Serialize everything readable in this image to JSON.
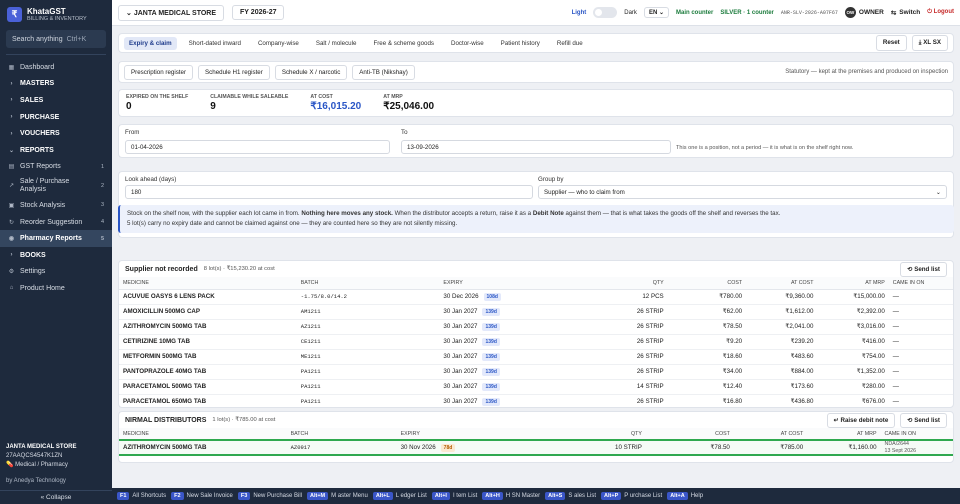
{
  "brand": {
    "name": "KhataGST",
    "sub": "BILLING & INVENTORY",
    "logo": "₹"
  },
  "sidebar": {
    "search_placeholder": "Search anything",
    "search_shortcut": "Ctrl+K",
    "items": [
      {
        "label": "Dashboard",
        "icon": "grid-icon",
        "glyph": "▦",
        "group": false
      },
      {
        "label": "MASTERS",
        "icon": "chevron-right-icon",
        "glyph": "›",
        "group": true
      },
      {
        "label": "SALES",
        "icon": "chevron-right-icon",
        "glyph": "›",
        "group": true
      },
      {
        "label": "PURCHASE",
        "icon": "chevron-right-icon",
        "glyph": "›",
        "group": true
      },
      {
        "label": "VOUCHERS",
        "icon": "chevron-right-icon",
        "glyph": "›",
        "group": true
      },
      {
        "label": "REPORTS",
        "icon": "chevron-down-icon",
        "glyph": "⌄",
        "group": true
      },
      {
        "label": "GST Reports",
        "icon": "report-icon",
        "glyph": "▤",
        "count": "1"
      },
      {
        "label": "Sale / Purchase Analysis",
        "icon": "chart-icon",
        "glyph": "↗",
        "count": "2",
        "two": true
      },
      {
        "label": "Stock Analysis",
        "icon": "box-icon",
        "glyph": "▣",
        "count": "3"
      },
      {
        "label": "Reorder Suggestion",
        "icon": "refresh-icon",
        "glyph": "↻",
        "count": "4"
      },
      {
        "label": "Pharmacy Reports",
        "icon": "pill-icon",
        "glyph": "◉",
        "count": "5",
        "active": true
      },
      {
        "label": "BOOKS",
        "icon": "chevron-right-icon",
        "glyph": "›",
        "group": true
      },
      {
        "label": "Settings",
        "icon": "gear-icon",
        "glyph": "⚙"
      },
      {
        "label": "Product Home",
        "icon": "home-icon",
        "glyph": "⌂"
      }
    ],
    "shop_name": "JANTA MEDICAL STORE",
    "shop_gstin": "27AAQCS4547K1ZN",
    "shop_type": "Medical / Pharmacy",
    "powered": "by Anedya Technology",
    "collapse": "« Collapse"
  },
  "topbar": {
    "store": "JANTA MEDICAL STORE",
    "fy": "FY 2026-27",
    "light": "Light",
    "dark": "Dark",
    "lang": "EN",
    "main_counter": "Main counter",
    "plan": "SILVER · 1 counter",
    "license": "ANR-SLV-2026-A07F67",
    "avatar": "OW",
    "owner": "OWNER",
    "switch": "Switch",
    "logout": "Logout"
  },
  "tabs": [
    {
      "label": "Expiry & claim",
      "active": true
    },
    {
      "label": "Short-dated inward"
    },
    {
      "label": "Company-wise"
    },
    {
      "label": "Salt / molecule"
    },
    {
      "label": "Free & scheme goods"
    },
    {
      "label": "Doctor-wise"
    },
    {
      "label": "Patient history"
    },
    {
      "label": "Refill due"
    }
  ],
  "tab_actions": {
    "reset": "Reset",
    "xlsx": "XL SX"
  },
  "subtabs": [
    "Prescription register",
    "Schedule H1 register",
    "Schedule X / narcotic",
    "Anti-TB (Nikshay)"
  ],
  "statutory_note": "Statutory — kept at the premises and produced on inspection",
  "stats": [
    {
      "label": "EXPIRED ON THE SHELF",
      "value": "0"
    },
    {
      "label": "CLAIMABLE WHILE SALEABLE",
      "value": "9"
    },
    {
      "label": "AT COST",
      "value": "₹16,015.20",
      "blue": true
    },
    {
      "label": "AT MRP",
      "value": "₹25,046.00"
    }
  ],
  "filters": {
    "from_label": "From",
    "from_value": "01-04-2026",
    "to_label": "To",
    "to_value": "13-09-2026",
    "position_note": "This one is a position, not a period — it is what is on the shelf right now.",
    "lookahead_label": "Look ahead (days)",
    "lookahead_value": "180",
    "groupby_label": "Group by",
    "groupby_value": "Supplier — who to claim from"
  },
  "info": {
    "p1": "Stock on the shelf now, with the supplier each lot came in from.",
    "b1": "Nothing here moves any stock.",
    "p2": "When the distributor accepts a return, raise it as a",
    "b2": "Debit Note",
    "p3": "against them — that is what takes the goods off the shelf and reverses the tax.",
    "line2": "5 lot(s) carry no expiry date and cannot be claimed against one — they are counted here so they are not silently missing."
  },
  "columns": [
    "MEDICINE",
    "BATCH",
    "EXPIRY",
    "QTY",
    "COST",
    "AT COST",
    "AT MRP",
    "CAME IN ON"
  ],
  "group1": {
    "title": "Supplier not recorded",
    "meta": "8 lot(s) · ₹15,230.20 at cost",
    "send": "Send list",
    "rows": [
      {
        "medicine": "ACUVUE OASYS 6 LENS PACK",
        "batch": "-1.75/8.0/14.2",
        "expiry": "30 Dec 2026",
        "days": "108d",
        "qty": "12 PCS",
        "cost": "₹780.00",
        "at_cost": "₹9,360.00",
        "at_mrp": "₹15,000.00",
        "came": "—"
      },
      {
        "medicine": "AMOXICILLIN 500MG CAP",
        "batch": "AM1211",
        "expiry": "30 Jan 2027",
        "days": "139d",
        "qty": "26 STRIP",
        "cost": "₹62.00",
        "at_cost": "₹1,612.00",
        "at_mrp": "₹2,392.00",
        "came": "—"
      },
      {
        "medicine": "AZITHROMYCIN 500MG TAB",
        "batch": "AZ1211",
        "expiry": "30 Jan 2027",
        "days": "139d",
        "qty": "26 STRIP",
        "cost": "₹78.50",
        "at_cost": "₹2,041.00",
        "at_mrp": "₹3,016.00",
        "came": "—"
      },
      {
        "medicine": "CETIRIZINE 10MG TAB",
        "batch": "CE1211",
        "expiry": "30 Jan 2027",
        "days": "139d",
        "qty": "26 STRIP",
        "cost": "₹9.20",
        "at_cost": "₹239.20",
        "at_mrp": "₹416.00",
        "came": "—"
      },
      {
        "medicine": "METFORMIN 500MG TAB",
        "batch": "ME1211",
        "expiry": "30 Jan 2027",
        "days": "139d",
        "qty": "26 STRIP",
        "cost": "₹18.60",
        "at_cost": "₹483.60",
        "at_mrp": "₹754.00",
        "came": "—"
      },
      {
        "medicine": "PANTOPRAZOLE 40MG TAB",
        "batch": "PA1211",
        "expiry": "30 Jan 2027",
        "days": "139d",
        "qty": "26 STRIP",
        "cost": "₹34.00",
        "at_cost": "₹884.00",
        "at_mrp": "₹1,352.00",
        "came": "—"
      },
      {
        "medicine": "PARACETAMOL 500MG TAB",
        "batch": "PA1211",
        "expiry": "30 Jan 2027",
        "days": "139d",
        "qty": "14 STRIP",
        "cost": "₹12.40",
        "at_cost": "₹173.60",
        "at_mrp": "₹280.00",
        "came": "—"
      },
      {
        "medicine": "PARACETAMOL 650MG TAB",
        "batch": "PA1211",
        "expiry": "30 Jan 2027",
        "days": "139d",
        "qty": "26 STRIP",
        "cost": "₹16.80",
        "at_cost": "₹436.80",
        "at_mrp": "₹676.00",
        "came": "—"
      }
    ]
  },
  "group2": {
    "title": "NIRMAL DISTRIBUTORS",
    "meta": "1 lot(s) · ₹785.00 at cost",
    "raise": "Raise debit note",
    "send": "Send list",
    "rows": [
      {
        "medicine": "AZITHROMYCIN 500MG TAB",
        "batch": "AZ0917",
        "expiry": "30 Nov 2026",
        "days": "78d",
        "qty": "10 STRIP",
        "cost": "₹78.50",
        "at_cost": "₹785.00",
        "at_mrp": "₹1,160.00",
        "came1": "NDA/2644",
        "came2": "13 Sept 2026"
      }
    ]
  },
  "footer": [
    {
      "key": "F1",
      "label": "All Shortcuts"
    },
    {
      "key": "F2",
      "label": "New Sale Invoice"
    },
    {
      "key": "F3",
      "label": "New Purchase Bill"
    },
    {
      "key": "Alt+M",
      "label": "M aster Menu"
    },
    {
      "key": "Alt+L",
      "label": "L edger List"
    },
    {
      "key": "Alt+I",
      "label": "I tem List"
    },
    {
      "key": "Alt+H",
      "label": "H SN Master"
    },
    {
      "key": "Alt+S",
      "label": "S ales List"
    },
    {
      "key": "Alt+P",
      "label": "P urchase List"
    },
    {
      "key": "Alt+A",
      "label": "Help"
    }
  ]
}
